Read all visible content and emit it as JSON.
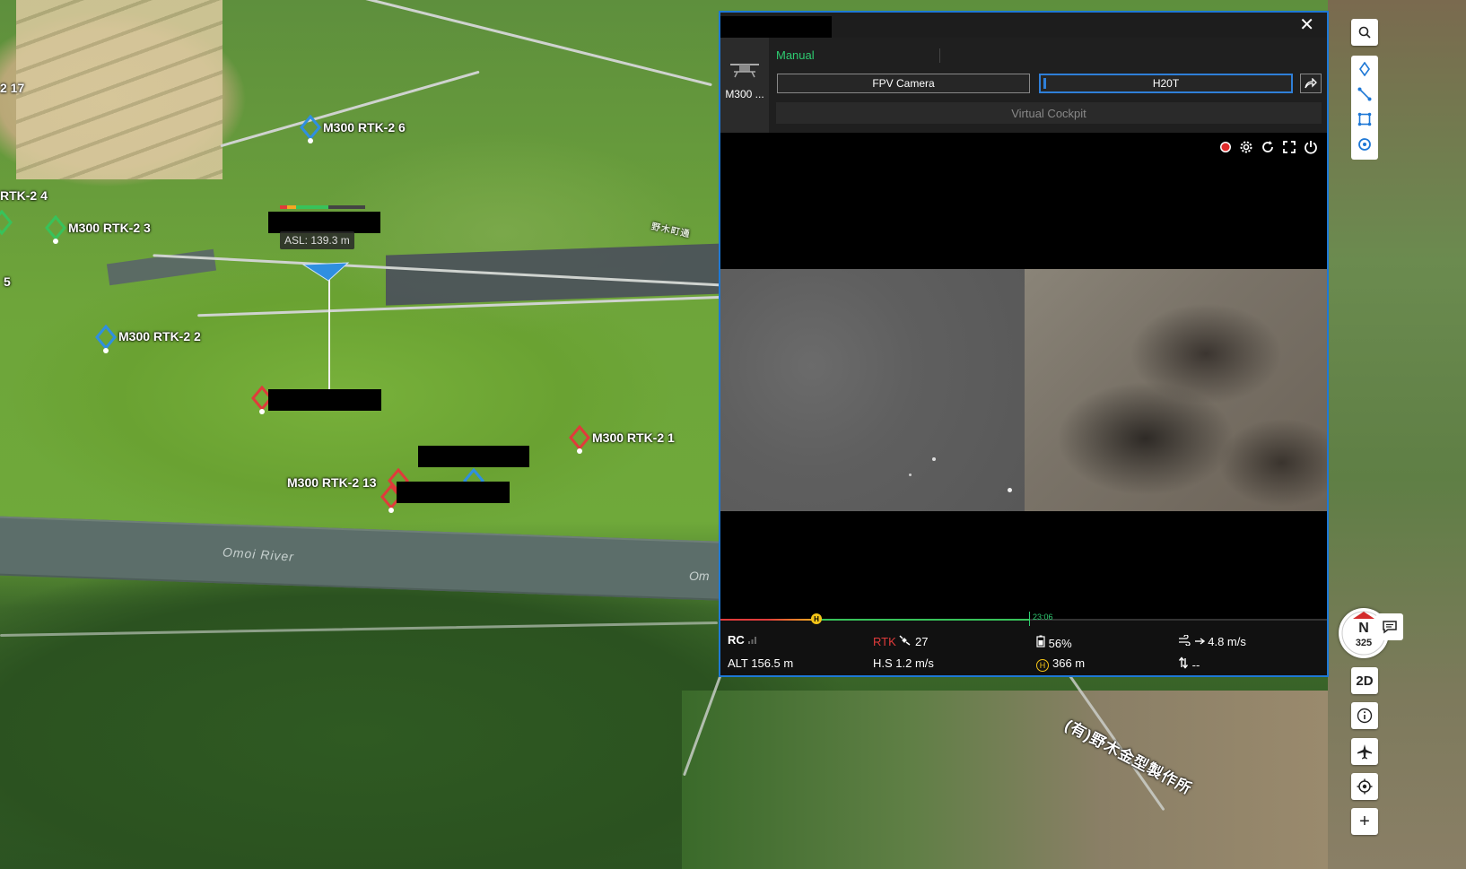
{
  "map": {
    "river_label": "Omoi River",
    "river_label_cut": "Om",
    "place_labels": [
      "(有)野木金型製作所",
      "野木町通"
    ],
    "edge_labels": [
      "2 17",
      "RTK-2 4",
      "5"
    ],
    "waypoints": [
      {
        "label": "M300 RTK-2 6",
        "color": "#2f8fe0"
      },
      {
        "label": "M300 RTK-2 3",
        "color": "#38c25a"
      },
      {
        "label": "M300 RTK-2 2",
        "color": "#2f8fe0"
      },
      {
        "label": "M300 RTK-2 1",
        "color": "#e03b3b"
      },
      {
        "label": "M300 RTK-2 13",
        "color": "#e03b3b"
      }
    ],
    "drone": {
      "asl": "ASL: 139.3 m"
    }
  },
  "panel": {
    "close_label": "✕",
    "drone_name": "M300 ...",
    "mode": "Manual",
    "cameras": [
      "FPV Camera",
      "H20T"
    ],
    "active_camera": "H20T",
    "virtual_cockpit": "Virtual Cockpit",
    "progress": {
      "time": "23:06",
      "home_marker": "H"
    },
    "status": {
      "rc_label": "RC",
      "rtk_label": "RTK",
      "satellites": "27",
      "battery": "56%",
      "wind": "4.8 m/s",
      "alt": "ALT 156.5 m",
      "hs": "H.S 1.2 m/s",
      "home_dist": "366 m",
      "vs": "--"
    }
  },
  "toolbar": {
    "view_2d": "2D",
    "compass_dir": "N",
    "compass_deg": "325",
    "plus": "+"
  },
  "colors": {
    "accent": "#1e78d6",
    "mode_green": "#2ecc71",
    "warning_red": "#e03b3b"
  }
}
